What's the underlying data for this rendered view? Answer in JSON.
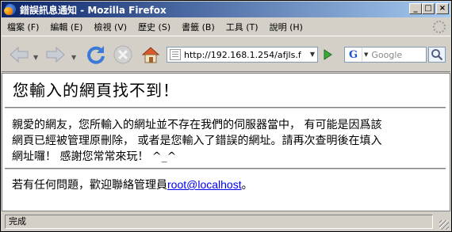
{
  "window": {
    "title": "錯誤訊息通知 - Mozilla Firefox",
    "buttons": {
      "minimize": "_",
      "maximize": "□",
      "close": "×"
    }
  },
  "menubar": {
    "items": [
      {
        "label": "檔案 (F)"
      },
      {
        "label": "編輯 (E)"
      },
      {
        "label": "檢視 (V)"
      },
      {
        "label": "歷史 (S)"
      },
      {
        "label": "書籤 (B)"
      },
      {
        "label": "工具 (T)"
      },
      {
        "label": "說明 (H)"
      }
    ]
  },
  "navbar": {
    "url": "http://192.168.1.254/afjls.f",
    "search_placeholder": "Google",
    "search_engine_logo": "G",
    "icons": [
      "back-arrow-icon",
      "forward-arrow-icon",
      "reload-icon",
      "stop-icon",
      "home-icon",
      "page-icon",
      "go-arrow-icon",
      "google-icon",
      "magnifier-icon"
    ]
  },
  "page": {
    "heading": "您輸入的網頁找不到！",
    "paragraph_lines": [
      "親愛的網友，您所輸入的網址並不存在我們的伺服器當中， 有可能是因爲該",
      "網頁已經被管理原刪除， 或者是您輸入了錯誤的網址。請再次查明後在填入",
      "網址囉！ 感謝您常常來玩！ ^_^"
    ],
    "contact_prefix": "若有任何問題，歡迎聯絡管理員",
    "contact_email": "root@localhost",
    "contact_suffix": "。"
  },
  "statusbar": {
    "text": "完成"
  },
  "colors": {
    "title_start": "#0a246a",
    "title_end": "#a6caf0",
    "link": "#0000ee",
    "chrome": "#d4d0c8"
  }
}
